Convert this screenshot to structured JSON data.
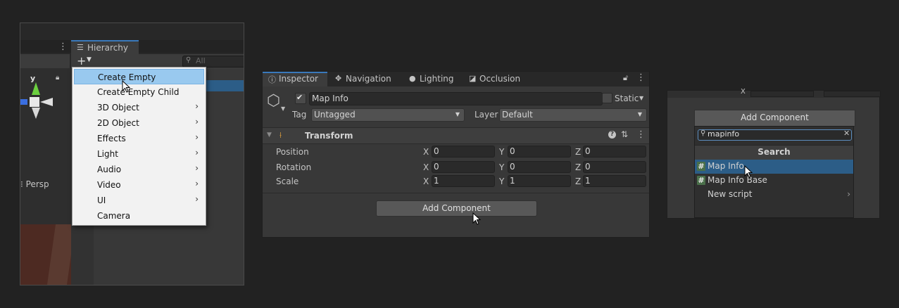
{
  "hierarchy": {
    "tab_label": "Hierarchy",
    "search_placeholder": "All",
    "scene_view_label": "Persp",
    "gizmo_axis_label": "y"
  },
  "create_menu": {
    "items": [
      {
        "label": "Create Empty",
        "has_submenu": false,
        "highlighted": true
      },
      {
        "label": "Create Empty Child",
        "has_submenu": false,
        "highlighted": false
      },
      {
        "label": "3D Object",
        "has_submenu": true,
        "highlighted": false
      },
      {
        "label": "2D Object",
        "has_submenu": true,
        "highlighted": false
      },
      {
        "label": "Effects",
        "has_submenu": true,
        "highlighted": false
      },
      {
        "label": "Light",
        "has_submenu": true,
        "highlighted": false
      },
      {
        "label": "Audio",
        "has_submenu": true,
        "highlighted": false
      },
      {
        "label": "Video",
        "has_submenu": true,
        "highlighted": false
      },
      {
        "label": "UI",
        "has_submenu": true,
        "highlighted": false
      },
      {
        "label": "Camera",
        "has_submenu": false,
        "highlighted": false
      }
    ],
    "submenu_arrow": "›"
  },
  "inspector": {
    "tabs": [
      {
        "label": "Inspector",
        "icon": "info-icon",
        "active": true
      },
      {
        "label": "Navigation",
        "icon": "navigation-icon",
        "active": false
      },
      {
        "label": "Lighting",
        "icon": "bulb-icon",
        "active": false
      },
      {
        "label": "Occlusion",
        "icon": "occlusion-icon",
        "active": false
      }
    ],
    "object_name": "Map Info",
    "active": true,
    "static_label": "Static",
    "tag_label": "Tag",
    "tag_value": "Untagged",
    "layer_label": "Layer",
    "layer_value": "Default",
    "transform": {
      "title": "Transform",
      "axis_labels": [
        "X",
        "Y",
        "Z"
      ],
      "rows": [
        {
          "label": "Position",
          "values": [
            "0",
            "0",
            "0"
          ]
        },
        {
          "label": "Rotation",
          "values": [
            "0",
            "0",
            "0"
          ]
        },
        {
          "label": "Scale",
          "values": [
            "1",
            "1",
            "1"
          ]
        }
      ]
    },
    "add_component_label": "Add Component"
  },
  "add_component_popup": {
    "button_label": "Add Component",
    "search_value": "mapinfo",
    "section_header": "Search",
    "results": [
      {
        "label": "Map Info",
        "icon": "script-icon",
        "selected": true,
        "has_submenu": false
      },
      {
        "label": "Map Info Base",
        "icon": "script-icon",
        "selected": false,
        "has_submenu": false
      },
      {
        "label": "New script",
        "icon": "",
        "selected": false,
        "has_submenu": true
      }
    ],
    "top_axis_label": "X"
  },
  "colors": {
    "editor_bg": "#383838",
    "selection_blue": "#2c5d87",
    "menu_highlight": "#99c9ef",
    "tab_accent": "#3a79bb"
  }
}
